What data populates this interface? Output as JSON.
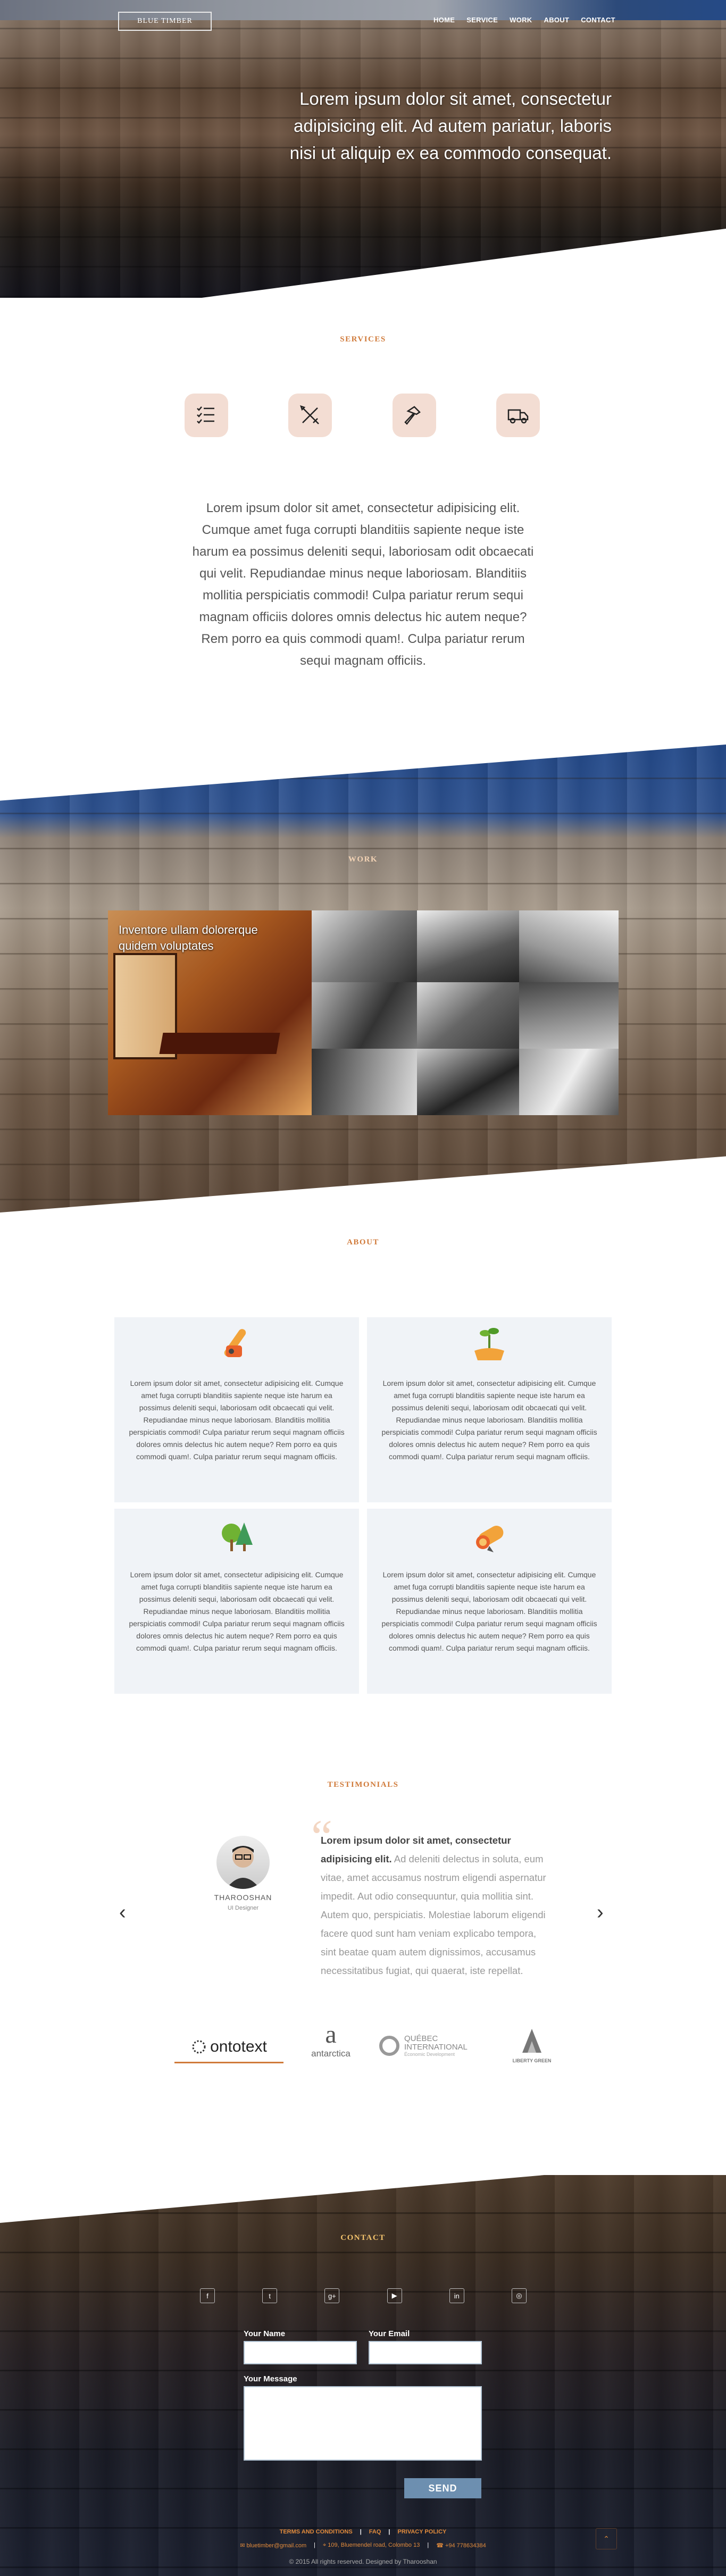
{
  "header": {
    "logo": "BLUE TIMBER",
    "nav": [
      "HOME",
      "SERVICE",
      "WORK",
      "ABOUT",
      "CONTACT"
    ]
  },
  "hero": {
    "text": "Lorem ipsum dolor sit amet, consectetur adipisicing elit. Ad autem pariatur, laboris nisi ut aliquip ex ea commodo consequat."
  },
  "services": {
    "title": "SERVICES",
    "icons": [
      "checklist-icon",
      "tools-icon",
      "hammer-icon",
      "delivery-truck-icon"
    ],
    "text": "Lorem ipsum dolor sit amet, consectetur adipisicing elit. Cumque amet fuga corrupti blanditiis sapiente neque iste harum ea possimus deleniti sequi, laboriosam odit obcaecati qui velit. Repudiandae minus neque laboriosam. Blanditiis mollitia perspiciatis commodi! Culpa pariatur rerum sequi magnam officiis dolores omnis delectus hic autem neque? Rem porro ea quis commodi quam!. Culpa pariatur rerum sequi magnam officiis."
  },
  "work": {
    "title": "WORK",
    "caption": "Inventore ullam dolorerque quidem voluptates"
  },
  "about": {
    "title": "ABOUT",
    "cards": [
      {
        "icon": "chainsaw-icon",
        "text": "Lorem ipsum dolor sit amet, consectetur adipisicing elit. Cumque amet fuga corrupti blanditiis sapiente neque iste harum ea possimus deleniti sequi, laboriosam odit obcaecati qui velit. Repudiandae minus neque laboriosam. Blanditiis mollitia perspiciatis commodi! Culpa pariatur rerum sequi magnam officiis dolores omnis delectus hic autem neque? Rem porro ea quis commodi quam!. Culpa pariatur rerum sequi magnam officiis."
      },
      {
        "icon": "plant-in-hand-icon",
        "text": "Lorem ipsum dolor sit amet, consectetur adipisicing elit. Cumque amet fuga corrupti blanditiis sapiente neque iste harum ea possimus deleniti sequi, laboriosam odit obcaecati qui velit. Repudiandae minus neque laboriosam. Blanditiis mollitia perspiciatis commodi! Culpa pariatur rerum sequi magnam officiis dolores omnis delectus hic autem neque? Rem porro ea quis commodi quam!. Culpa pariatur rerum sequi magnam officiis."
      },
      {
        "icon": "trees-icon",
        "text": "Lorem ipsum dolor sit amet, consectetur adipisicing elit. Cumque amet fuga corrupti blanditiis sapiente neque iste harum ea possimus deleniti sequi, laboriosam odit obcaecati qui velit. Repudiandae minus neque laboriosam. Blanditiis mollitia perspiciatis commodi! Culpa pariatur rerum sequi magnam officiis dolores omnis delectus hic autem neque? Rem porro ea quis commodi quam!. Culpa pariatur rerum sequi magnam officiis."
      },
      {
        "icon": "log-icon",
        "text": "Lorem ipsum dolor sit amet, consectetur adipisicing elit. Cumque amet fuga corrupti blanditiis sapiente neque iste harum ea possimus deleniti sequi, laboriosam odit obcaecati qui velit. Repudiandae minus neque laboriosam. Blanditiis mollitia perspiciatis commodi! Culpa pariatur rerum sequi magnam officiis dolores omnis delectus hic autem neque? Rem porro ea quis commodi quam!. Culpa pariatur rerum sequi magnam officiis."
      }
    ]
  },
  "testimonials": {
    "title": "TESTIMONIALS",
    "name": "THAROOSHAN",
    "role": "UI Designer",
    "quote_bold": "Lorem ipsum dolor sit amet, consectetur adipisicing elit.",
    "quote_rest": " Ad deleniti delectus in soluta, eum vitae, amet accusamus nostrum eligendi aspernatur impedit. Aut odio consequuntur, quia mollitia sint. Autem quo, perspiciatis. Molestiae laborum eligendi facere quod sunt ham veniam explicabo tempora, sint beatae quam autem dignissimos, accusamus necessitatibus fugiat, qui quaerat, iste repellat.",
    "brands": [
      "ontotext",
      "antarctica",
      "QUÉBEC INTERNATIONAL",
      "Économic Development",
      "LIBERTY GREEN"
    ]
  },
  "contact": {
    "title": "CONTACT",
    "social": [
      "facebook-icon",
      "twitter-icon",
      "google-plus-icon",
      "youtube-icon",
      "linkedin-icon",
      "dribbble-icon"
    ],
    "name_label": "Your Name",
    "email_label": "Your Email",
    "message_label": "Your Message",
    "send": "SEND",
    "links": [
      "TERMS AND CONDITIONS",
      "FAQ",
      "PRIVACY POLICY"
    ],
    "email": "bluetimber@gmail.com",
    "address": "109, Bluemendel road, Colombo 13",
    "phone": "+94 778634384",
    "copyright": "© 2015 All rights reserved. Designed by Tharooshan"
  }
}
